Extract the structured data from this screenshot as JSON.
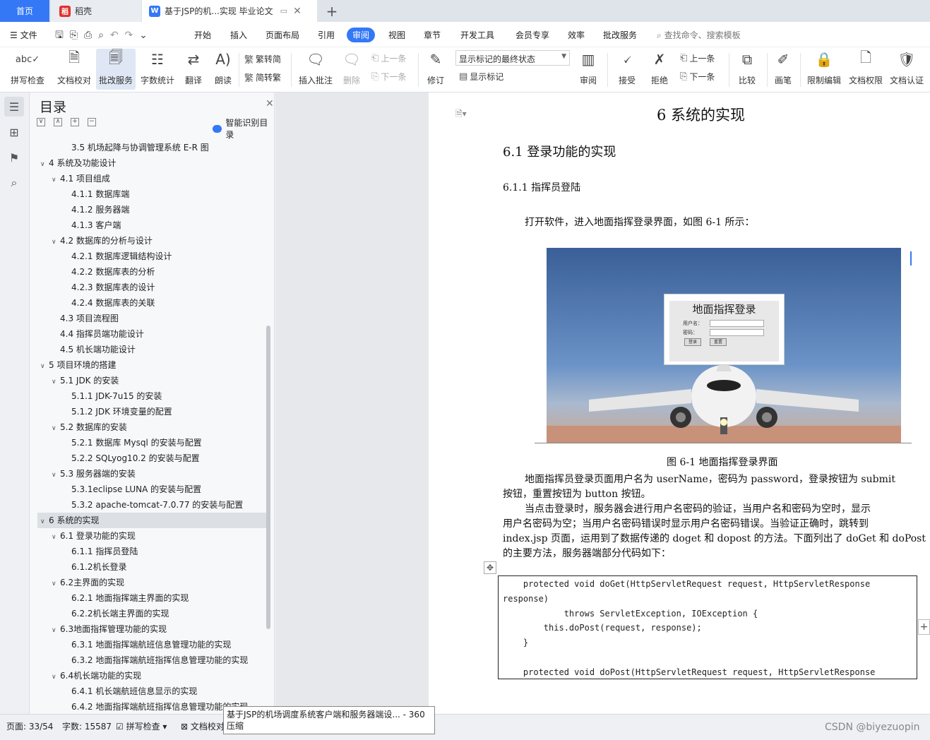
{
  "tabs": {
    "home": "首页",
    "daoke": "稻壳",
    "doc": "基于JSP的机...实现 毕业论文",
    "new_tab": "+"
  },
  "menu": {
    "file": "文件",
    "items": [
      "开始",
      "插入",
      "页面布局",
      "引用",
      "审阅",
      "视图",
      "章节",
      "开发工具",
      "会员专享",
      "效率",
      "批改服务"
    ],
    "search_placeholder": "查找命令、搜索模板"
  },
  "ribbon": {
    "spellcheck": "拼写检查",
    "proofread": "文档校对",
    "correction": "批改服务",
    "wordcount": "字数统计",
    "translate": "翻译",
    "read_aloud": "朗读",
    "trad": "繁转简",
    "simp": "简转繁",
    "insert_comment": "插入批注",
    "delete": "删除",
    "prev": "上一条",
    "next": "下一条",
    "revise": "修订",
    "mark_state": "显示标记的最终状态",
    "show_marks": "显示标记",
    "review": "审阅",
    "accept": "接受",
    "reject": "拒绝",
    "prev2": "上一条",
    "next2": "下一条",
    "compare": "比较",
    "pen": "画笔",
    "restrict": "限制编辑",
    "permission": "文档权限",
    "certify": "文档认证"
  },
  "toc": {
    "title": "目录",
    "smart": "智能识别目录",
    "items": [
      {
        "label": "3.5 机场起降与协调管理系统 E-R 图",
        "level": 2,
        "arrow": ""
      },
      {
        "label": "4    系统及功能设计",
        "level": 0,
        "arrow": "∨"
      },
      {
        "label": "4.1  项目组成",
        "level": 1,
        "arrow": "∨"
      },
      {
        "label": "4.1.1  数据库端",
        "level": 2,
        "arrow": ""
      },
      {
        "label": "4.1.2  服务器端",
        "level": 2,
        "arrow": ""
      },
      {
        "label": "4.1.3  客户端",
        "level": 2,
        "arrow": ""
      },
      {
        "label": "4.2  数据库的分析与设计",
        "level": 1,
        "arrow": "∨"
      },
      {
        "label": "4.2.1  数据库逻辑结构设计",
        "level": 2,
        "arrow": ""
      },
      {
        "label": "4.2.2  数据库表的分析",
        "level": 2,
        "arrow": ""
      },
      {
        "label": "4.2.3  数据库表的设计",
        "level": 2,
        "arrow": ""
      },
      {
        "label": "4.2.4  数据库表的关联",
        "level": 2,
        "arrow": ""
      },
      {
        "label": "4.3  项目流程图",
        "level": 1,
        "arrow": ""
      },
      {
        "label": "4.4  指挥员端功能设计",
        "level": 1,
        "arrow": ""
      },
      {
        "label": "4.5  机长端功能设计",
        "level": 1,
        "arrow": ""
      },
      {
        "label": "5    项目环境的搭建",
        "level": 0,
        "arrow": "∨"
      },
      {
        "label": "5.1 JDK 的安装",
        "level": 1,
        "arrow": "∨"
      },
      {
        "label": "5.1.1 JDK-7u15 的安装",
        "level": 2,
        "arrow": ""
      },
      {
        "label": "5.1.2 JDK 环境变量的配置",
        "level": 2,
        "arrow": ""
      },
      {
        "label": "5.2  数据库的安装",
        "level": 1,
        "arrow": "∨"
      },
      {
        "label": "5.2.1  数据库 Mysql 的安装与配置",
        "level": 2,
        "arrow": ""
      },
      {
        "label": "5.2.2 SQLyog10.2 的安装与配置",
        "level": 2,
        "arrow": ""
      },
      {
        "label": "5.3  服务器端的安装",
        "level": 1,
        "arrow": "∨"
      },
      {
        "label": "5.3.1eclipse LUNA 的安装与配置",
        "level": 2,
        "arrow": ""
      },
      {
        "label": "5.3.2 apache-tomcat-7.0.77 的安装与配置",
        "level": 2,
        "arrow": ""
      },
      {
        "label": "6    系统的实现",
        "level": 0,
        "arrow": "∨"
      },
      {
        "label": "6.1 登录功能的实现",
        "level": 1,
        "arrow": "∨"
      },
      {
        "label": "6.1.1  指挥员登陆",
        "level": 2,
        "arrow": ""
      },
      {
        "label": "6.1.2机长登录",
        "level": 2,
        "arrow": ""
      },
      {
        "label": "6.2主界面的实现",
        "level": 1,
        "arrow": "∨"
      },
      {
        "label": "6.2.1  地面指挥端主界面的实现",
        "level": 2,
        "arrow": ""
      },
      {
        "label": "6.2.2机长端主界面的实现",
        "level": 2,
        "arrow": ""
      },
      {
        "label": "6.3地面指挥管理功能的实现",
        "level": 1,
        "arrow": "∨"
      },
      {
        "label": "6.3.1  地面指挥端航班信息管理功能的实现",
        "level": 2,
        "arrow": ""
      },
      {
        "label": "6.3.2  地面指挥端航班指挥信息管理功能的实现",
        "level": 2,
        "arrow": ""
      },
      {
        "label": "6.4机长端功能的实现",
        "level": 1,
        "arrow": "∨"
      },
      {
        "label": "6.4.1  机长端航班信息显示的实现",
        "level": 2,
        "arrow": ""
      },
      {
        "label": "6.4.2  地面指挥端航班指挥信息管理功能的实现",
        "level": 2,
        "arrow": ""
      }
    ]
  },
  "doc": {
    "chapter": "6    系统的实现",
    "h2": "6.1 登录功能的实现",
    "h3": "6.1.1  指挥员登陆",
    "p1": "打开软件，进入地面指挥登录界面，如图 6-1 所示：",
    "figure": {
      "title": "地面指挥登录",
      "user_label": "用户名：",
      "pwd_label": "密码：",
      "login_btn": "登录",
      "reset_btn": "重置"
    },
    "caption": "图 6-1  地面指挥登录界面",
    "p2": [
      "地面指挥员登录页面用户名为 userName，密码为 password，登录按钮为 submit",
      "按钮，重置按钮为 button 按钮。"
    ],
    "p3": [
      "当点击登录时，服务器会进行用户名密码的验证，当用户名和密码为空时，显示",
      "用户名密码为空；当用户名密码错误时显示用户名密码错误。当验证正确时，跳转到",
      "index.jsp 页面，运用到了数据传递的 doget 和 dopost 的方法。下面列出了 doGet 和 doPost",
      "的主要方法，服务器端部分代码如下："
    ],
    "code": [
      "    protected void doGet(HttpServletRequest request, HttpServletResponse",
      "response)",
      "            throws ServletException, IOException {",
      "        this.doPost(request, response);",
      "    }",
      "",
      "    protected void doPost(HttpServletRequest request, HttpServletResponse"
    ]
  },
  "status": {
    "page": "页面: 33/54",
    "words": "字数: 15587",
    "spell": "拼写检查",
    "proof": "文档校对"
  },
  "tooltip": "基于JSP的机场调度系统客户端和服务器端设... - 360压缩",
  "watermark": "CSDN @biyezuopin"
}
